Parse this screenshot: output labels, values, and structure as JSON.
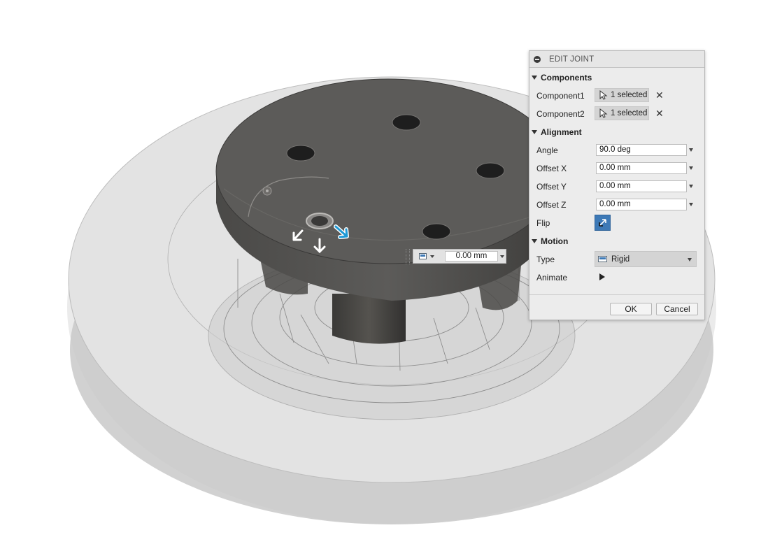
{
  "panel": {
    "title": "EDIT JOINT",
    "sections": {
      "components": "Components",
      "alignment": "Alignment",
      "motion": "Motion"
    },
    "component1": {
      "label": "Component1",
      "value": "1 selected"
    },
    "component2": {
      "label": "Component2",
      "value": "1 selected"
    },
    "angle": {
      "label": "Angle",
      "value": "90.0 deg"
    },
    "offset_x": {
      "label": "Offset X",
      "value": "0.00 mm"
    },
    "offset_y": {
      "label": "Offset Y",
      "value": "0.00 mm"
    },
    "offset_z": {
      "label": "Offset Z",
      "value": "0.00 mm"
    },
    "flip": {
      "label": "Flip"
    },
    "type": {
      "label": "Type",
      "value": "Rigid"
    },
    "animate": {
      "label": "Animate"
    },
    "ok_label": "OK",
    "cancel_label": "Cancel"
  },
  "canvas_offset": {
    "value": "0.00 mm"
  },
  "colors": {
    "accent": "#3d79b6",
    "manipulator_arrow_active": "#1f9ad6",
    "part_face": "#5a5957",
    "ghost_body": "#d6d6d6"
  },
  "icons": {
    "selection": "cursor-arrow-icon",
    "clear": "close-x-icon",
    "flip": "flip-arrows-icon",
    "rigid": "rigid-joint-icon",
    "animate": "play-icon"
  }
}
